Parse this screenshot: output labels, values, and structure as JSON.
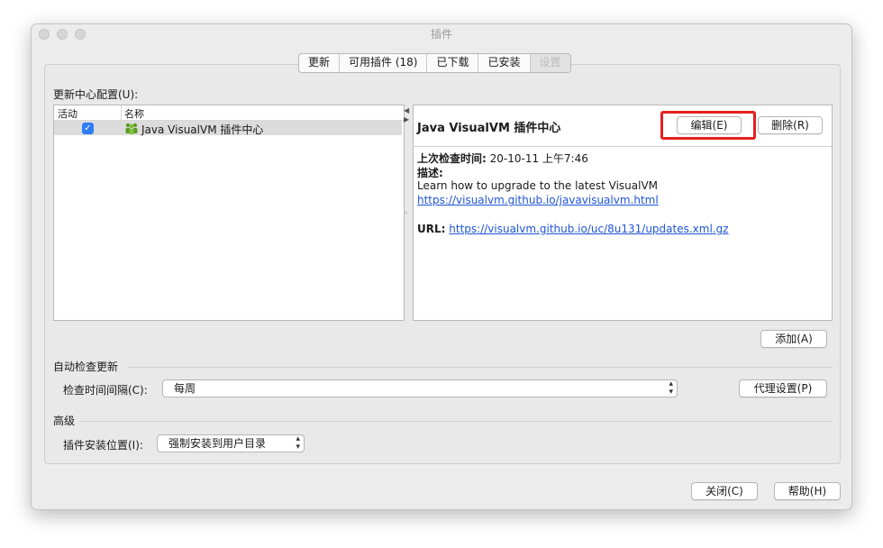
{
  "window": {
    "title": "插件"
  },
  "tabs": [
    {
      "label": "更新"
    },
    {
      "label": "可用插件 (18)"
    },
    {
      "label": "已下载"
    },
    {
      "label": "已安装"
    },
    {
      "label": "设置",
      "active": true
    }
  ],
  "update_center": {
    "label": "更新中心配置(U):",
    "columns": {
      "active": "活动",
      "name": "名称"
    },
    "rows": [
      {
        "active": true,
        "name": "Java VisualVM 插件中心"
      }
    ]
  },
  "detail": {
    "title": "Java VisualVM 插件中心",
    "edit_label": "编辑(E)",
    "delete_label": "删除(R)",
    "last_checked_label": "上次检查时间:",
    "last_checked_value": "20-10-11 上午7:46",
    "description_label": "描述:",
    "description_text": "Learn how to upgrade to the latest VisualVM",
    "description_link": "https://visualvm.github.io/javavisualvm.html",
    "url_label": "URL:",
    "url_value": "https://visualvm.github.io/uc/8u131/updates.xml.gz"
  },
  "add_label": "添加(A)",
  "auto_check": {
    "section": "自动检查更新",
    "interval_label": "检查时间间隔(C):",
    "interval_value": "每周",
    "proxy_label": "代理设置(P)"
  },
  "advanced": {
    "section": "高级",
    "install_location_label": "插件安装位置(I):",
    "install_location_value": "强制安装到用户目录"
  },
  "footer": {
    "close_label": "关闭(C)",
    "help_label": "帮助(H)"
  },
  "colors": {
    "highlight": "#e4201f",
    "link": "#1f55d8",
    "checkbox": "#2f7cf6"
  }
}
